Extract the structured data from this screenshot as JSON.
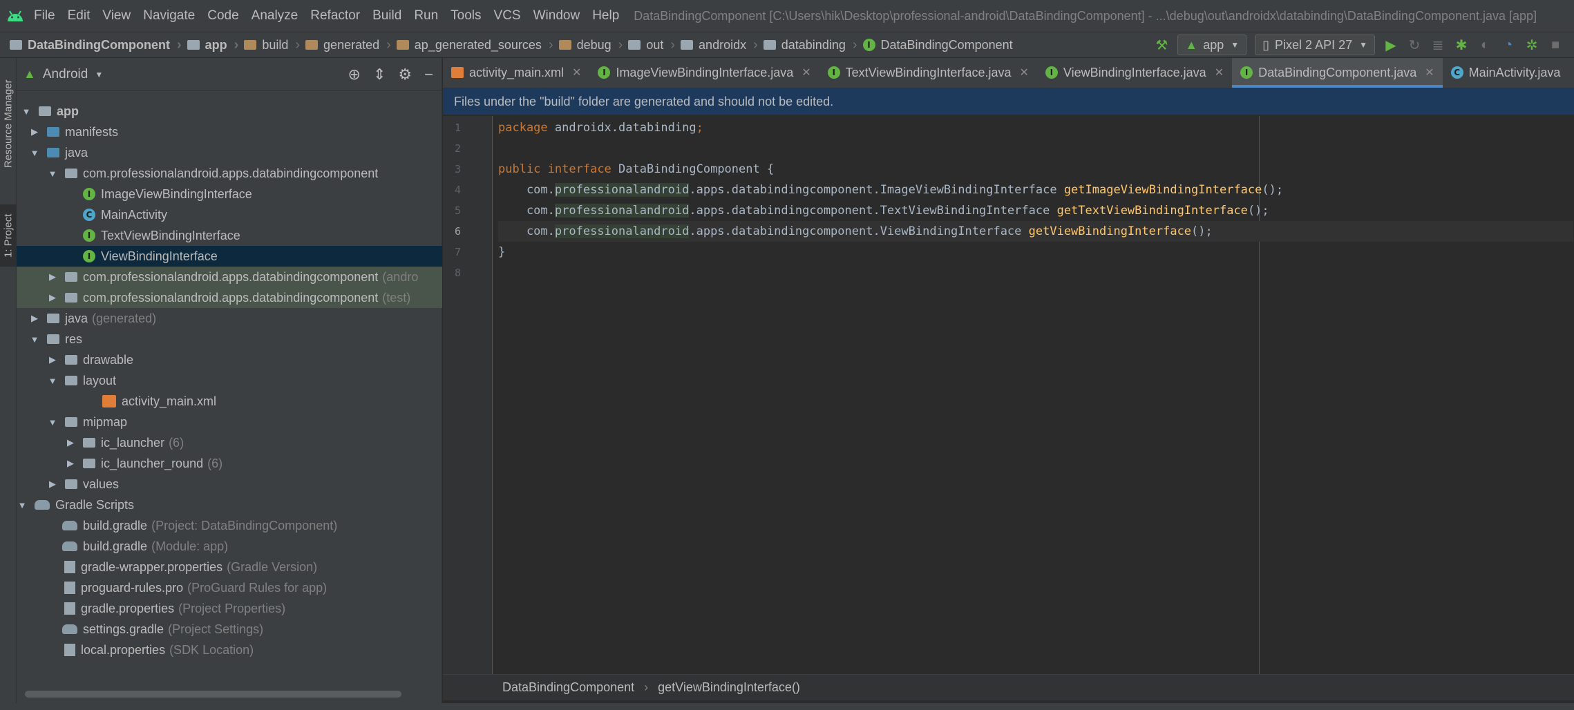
{
  "menubar": {
    "items": [
      "File",
      "Edit",
      "View",
      "Navigate",
      "Code",
      "Analyze",
      "Refactor",
      "Build",
      "Run",
      "Tools",
      "VCS",
      "Window",
      "Help"
    ],
    "title": "DataBindingComponent [C:\\Users\\hik\\Desktop\\professional-android\\DataBindingComponent] - ...\\debug\\out\\androidx\\databinding\\DataBindingComponent.java [app]"
  },
  "navbar": {
    "crumbs": [
      "DataBindingComponent",
      "app",
      "build",
      "generated",
      "ap_generated_sources",
      "debug",
      "out",
      "androidx",
      "databinding",
      "DataBindingComponent"
    ]
  },
  "toolbar": {
    "run_config": "app",
    "device": "Pixel 2 API 27"
  },
  "side_tabs": {
    "resource_manager": "Resource Manager",
    "project": "1: Project"
  },
  "project_panel": {
    "view_mode": "Android",
    "tree": [
      {
        "label": "app",
        "hint": ""
      },
      {
        "label": "manifests",
        "hint": ""
      },
      {
        "label": "java",
        "hint": ""
      },
      {
        "label": "com.professionalandroid.apps.databindingcomponent",
        "hint": ""
      },
      {
        "label": "ImageViewBindingInterface",
        "hint": ""
      },
      {
        "label": "MainActivity",
        "hint": ""
      },
      {
        "label": "TextViewBindingInterface",
        "hint": ""
      },
      {
        "label": "ViewBindingInterface",
        "hint": ""
      },
      {
        "label": "com.professionalandroid.apps.databindingcomponent",
        "hint": "(andro"
      },
      {
        "label": "com.professionalandroid.apps.databindingcomponent",
        "hint": "(test)"
      },
      {
        "label": "java",
        "hint": "(generated)"
      },
      {
        "label": "res",
        "hint": ""
      },
      {
        "label": "drawable",
        "hint": ""
      },
      {
        "label": "layout",
        "hint": ""
      },
      {
        "label": "activity_main.xml",
        "hint": ""
      },
      {
        "label": "mipmap",
        "hint": ""
      },
      {
        "label": "ic_launcher",
        "hint": "(6)"
      },
      {
        "label": "ic_launcher_round",
        "hint": "(6)"
      },
      {
        "label": "values",
        "hint": ""
      },
      {
        "label": "Gradle Scripts",
        "hint": ""
      },
      {
        "label": "build.gradle",
        "hint": "(Project: DataBindingComponent)"
      },
      {
        "label": "build.gradle",
        "hint": "(Module: app)"
      },
      {
        "label": "gradle-wrapper.properties",
        "hint": "(Gradle Version)"
      },
      {
        "label": "proguard-rules.pro",
        "hint": "(ProGuard Rules for app)"
      },
      {
        "label": "gradle.properties",
        "hint": "(Project Properties)"
      },
      {
        "label": "settings.gradle",
        "hint": "(Project Settings)"
      },
      {
        "label": "local.properties",
        "hint": "(SDK Location)"
      }
    ]
  },
  "editor": {
    "tabs": [
      {
        "label": "activity_main.xml"
      },
      {
        "label": "ImageViewBindingInterface.java"
      },
      {
        "label": "TextViewBindingInterface.java"
      },
      {
        "label": "ViewBindingInterface.java"
      },
      {
        "label": "DataBindingComponent.java"
      },
      {
        "label": "MainActivity.java"
      }
    ],
    "banner": "Files under the \"build\" folder are generated and should not be edited.",
    "line_numbers": [
      "1",
      "2",
      "3",
      "4",
      "5",
      "6",
      "7",
      "8"
    ],
    "code": {
      "l1_kw": "package",
      "l1_rest": " androidx.databinding",
      "l1_semi": ";",
      "l3_kw1": "public",
      "l3_kw2": "interface",
      "l3_rest": " DataBindingComponent {",
      "pkg_prefix": "    com.",
      "pkg_hl": "professionalandroid",
      "l4_type": ".apps.databindingcomponent.ImageViewBindingInterface ",
      "l4_fn": "getImageViewBindingInterface",
      "l5_type": ".apps.databindingcomponent.TextViewBindingInterface ",
      "l5_fn": "getTextViewBindingInterface",
      "l6_type": ".apps.databindingcomponent.ViewBindingInterface ",
      "l6_fn": "getViewBindingInterface",
      "call_end": "();",
      "l7": "}"
    },
    "breadcrumb": [
      "DataBindingComponent",
      "getViewBindingInterface()"
    ]
  }
}
